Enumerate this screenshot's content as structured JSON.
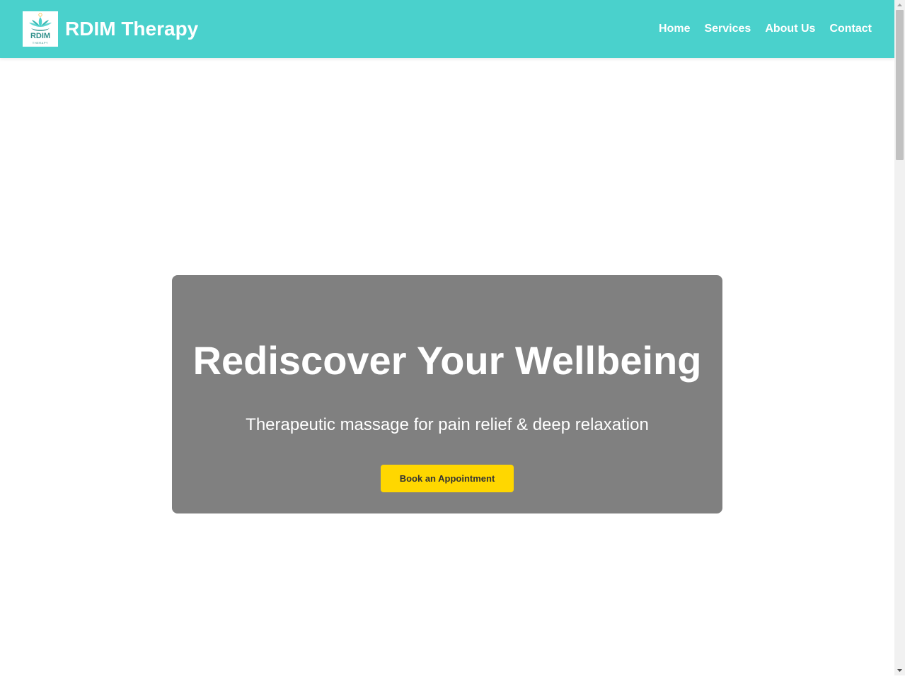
{
  "header": {
    "brand_name": "RDIM Therapy",
    "logo": {
      "icon": "lotus-logo-icon",
      "text": "RDIM",
      "subtext": "THERAPY"
    },
    "nav": [
      {
        "label": "Home"
      },
      {
        "label": "Services"
      },
      {
        "label": "About Us"
      },
      {
        "label": "Contact"
      }
    ]
  },
  "hero": {
    "title": "Rediscover Your Wellbeing",
    "subtitle": "Therapeutic massage for pain relief & deep relaxation",
    "cta_label": "Book an Appointment"
  },
  "colors": {
    "header_bg": "#4ad1cc",
    "hero_card_bg": "#808080",
    "cta_bg": "#ffd700",
    "logo_teal": "#2e8f8a"
  }
}
